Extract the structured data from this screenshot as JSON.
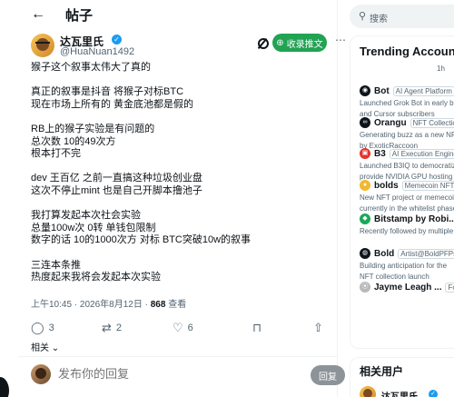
{
  "header": {
    "title": "帖子"
  },
  "author": {
    "name": "达瓦里氏",
    "handle": "@HuaNuan1492",
    "follow_label": "收录推文"
  },
  "post": {
    "lines": [
      "猴子这个叙事太伟大了真的",
      "",
      "真正的叙事是抖音 将猴子对标BTC",
      "现在市场上所有的 黄金底池都是假的",
      "",
      "RB上的猴子实验是有问题的",
      "总次数 10的49次方",
      "根本打不完",
      "",
      "dev 王百亿 之前一直搞这种垃圾创业盘",
      "这次不停止mint 也是自己开脚本撸池子",
      "",
      "我打算发起本次社会实验",
      "总量100w次 0转 单钱包限制",
      "数字的话 10的1000次方 对标 BTC突破10w的叙事",
      "",
      "三连本条推",
      "热度起来我将会发起本次实验"
    ],
    "timestamp": "上午10:45 · 2026年8月12日 · ",
    "views": "868",
    "views_label": " 查看"
  },
  "actions": {
    "replies": "3",
    "reposts": "2",
    "likes": "6",
    "related_label": "相关"
  },
  "reply": {
    "placeholder": "发布你的回复",
    "button_label": "回复"
  },
  "sidebar": {
    "search_placeholder": "搜索",
    "trending_title": "Trending Account",
    "trending_sub": "1h",
    "accounts": [
      {
        "name": "Bot",
        "tag": "AI Agent Platform",
        "desc": "Launched Grok Bot in early beta",
        "desc2": "and Cursor subscribers"
      },
      {
        "name": "Orangu",
        "tag": "NFT Collection",
        "desc": "Generating buzz as a new NFT",
        "desc2": "by ExoticRaccoon"
      },
      {
        "name": "B3",
        "tag": "AI Execution Engine",
        "desc": "Launched B3IQ to democratize",
        "desc2": "provide NVIDIA GPU hosting"
      },
      {
        "name": "bolds",
        "tag": "Memecoin NFT C",
        "desc": "New NFT project or memecoin",
        "desc2": "currently in the whitelist phase"
      },
      {
        "name": "Bitstamp by Robi...",
        "tag": "",
        "desc": "Recently followed by multiple",
        "desc2": ""
      },
      {
        "name": "Bold",
        "tag": "Artist@BoldPFPs",
        "desc": "Building anticipation for the",
        "desc2": "NFT collection launch"
      },
      {
        "name": "Jayme Leagh ...",
        "tag": "Fol",
        "desc": "",
        "desc2": ""
      }
    ],
    "related_title": "相关用户",
    "related_name": "达瓦里氏"
  }
}
